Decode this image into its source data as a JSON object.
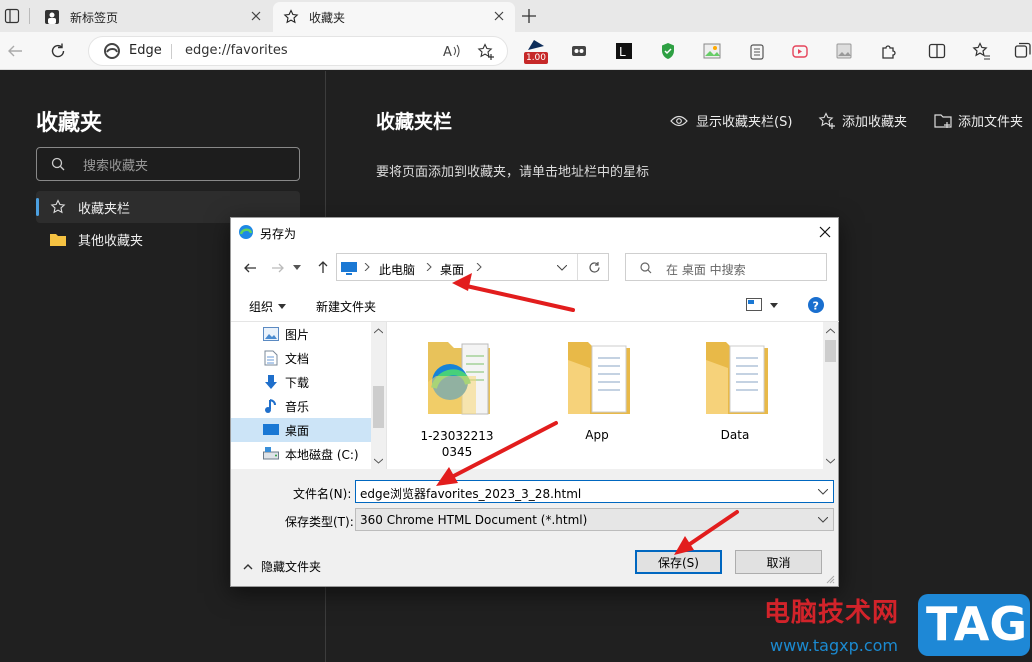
{
  "browser": {
    "tabs": [
      {
        "label": "新标签页"
      },
      {
        "label": "收藏夹"
      }
    ],
    "address": {
      "site": "Edge",
      "url": "edge://favorites"
    },
    "ext_badge": "1.00"
  },
  "sidebar": {
    "title": "收藏夹",
    "search_placeholder": "搜索收藏夹",
    "items": [
      {
        "label": "收藏夹栏"
      },
      {
        "label": "其他收藏夹"
      }
    ]
  },
  "main": {
    "title": "收藏夹栏",
    "actions": [
      {
        "label": "显示收藏夹栏(S)"
      },
      {
        "label": "添加收藏夹"
      },
      {
        "label": "添加文件夹"
      }
    ],
    "hint": "要将页面添加到收藏夹，请单击地址栏中的星标"
  },
  "dialog": {
    "title": "另存为",
    "breadcrumb": [
      "此电脑",
      "桌面"
    ],
    "search_placeholder": "在 桌面 中搜索",
    "organize": "组织",
    "new_folder": "新建文件夹",
    "nav": [
      {
        "label": "图片"
      },
      {
        "label": "文档"
      },
      {
        "label": "下载"
      },
      {
        "label": "音乐"
      },
      {
        "label": "桌面"
      },
      {
        "label": "本地磁盘 (C:)"
      }
    ],
    "files": [
      {
        "name": "1-230322130345"
      },
      {
        "name": "App"
      },
      {
        "name": "Data"
      }
    ],
    "filename_label": "文件名(N):",
    "filename_value": "edge浏览器favorites_2023_3_28.html",
    "filetype_label": "保存类型(T):",
    "filetype_value": "360 Chrome HTML Document (*.html)",
    "hide_folders": "隐藏文件夹",
    "save": "保存(S)",
    "cancel": "取消"
  },
  "watermark": {
    "site_name": "电脑技术网",
    "url": "www.tagxp.com",
    "logo": "TAG"
  },
  "colors": {
    "accent": "#0067c0",
    "annotation_arrow": "#e21d1d",
    "watermark_red": "#d2232a",
    "watermark_blue": "#1b8ad0"
  }
}
